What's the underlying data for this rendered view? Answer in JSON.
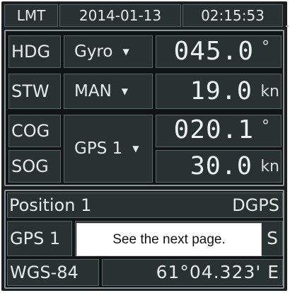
{
  "header": {
    "time_mode": "LMT",
    "date": "2014-01-13",
    "time": "02:15:53"
  },
  "nav": {
    "hdg": {
      "label": "HDG",
      "source": "Gyro",
      "value": "045.0",
      "unit": "°"
    },
    "stw": {
      "label": "STW",
      "source": "MAN",
      "value": "19.0",
      "unit": "kn"
    },
    "cog": {
      "label": "COG",
      "value": "020.1",
      "unit": "°"
    },
    "sog": {
      "label": "SOG",
      "value": "30.0",
      "unit": "kn"
    },
    "cog_sog_source": "GPS 1"
  },
  "position": {
    "title": "Position 1",
    "fix_type": "DGPS",
    "source": "GPS 1",
    "lat_hemisphere": "S",
    "datum": "WGS-84",
    "longitude": "61°04.323' E"
  },
  "tooltip": {
    "text": "See the next page."
  },
  "colors": {
    "background": "#1b1f20",
    "cell": "#2a3133",
    "border": "#8c9699"
  }
}
